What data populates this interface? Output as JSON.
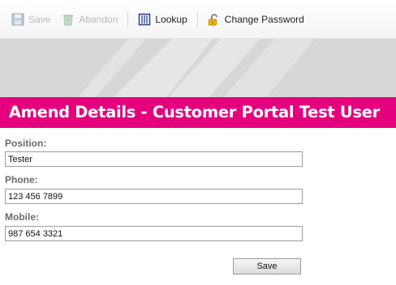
{
  "toolbar": {
    "save_label": "Save",
    "abandon_label": "Abandon",
    "lookup_label": "Lookup",
    "change_password_label": "Change Password",
    "icons": {
      "save": "floppy-disk-icon",
      "abandon": "recycle-bin-icon",
      "lookup": "lookup-list-icon",
      "change_password": "padlock-icon"
    }
  },
  "page": {
    "title": "Amend Details - Customer Portal Test User"
  },
  "form": {
    "position": {
      "label": "Position:",
      "value": "Tester"
    },
    "phone": {
      "label": "Phone:",
      "value": "123 456 7899"
    },
    "mobile": {
      "label": "Mobile:",
      "value": "987 654 3321"
    },
    "save_label": "Save"
  },
  "colors": {
    "accent": "#e5007e",
    "banner": "#d7d7d7",
    "label": "#6a6a6a"
  }
}
